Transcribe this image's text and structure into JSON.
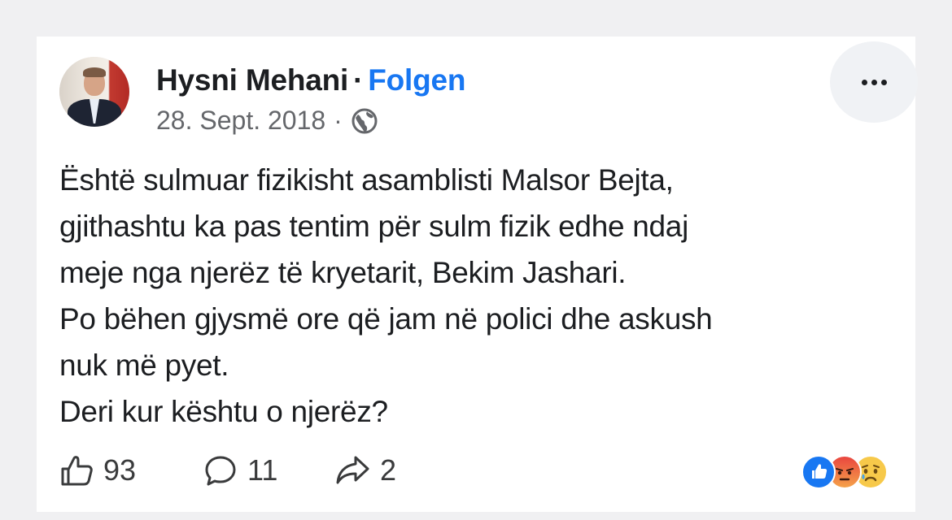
{
  "post": {
    "author": "Hysni Mehani",
    "separator": "·",
    "follow_label": "Folgen",
    "date": "28. Sept. 2018",
    "meta_separator": "·",
    "privacy_icon": "globe-icon",
    "more_icon": "more-options-icon",
    "text_lines": [
      "Është sulmuar fizikisht asamblisti Malsor Bejta,",
      "gjithashtu ka pas tentim për sulm fizik edhe ndaj",
      "meje nga njerëz të kryetarit, Bekim Jashari.",
      "Po bëhen gjysmë ore që jam në polici dhe askush",
      "nuk më pyet.",
      "Deri kur kështu o njerëz?"
    ]
  },
  "footer": {
    "likes": "93",
    "comments": "11",
    "shares": "2",
    "reactions": [
      "like",
      "angry",
      "sad"
    ]
  },
  "colors": {
    "accent": "#1877f2",
    "text": "#1c1e21",
    "muted": "#65676b"
  }
}
